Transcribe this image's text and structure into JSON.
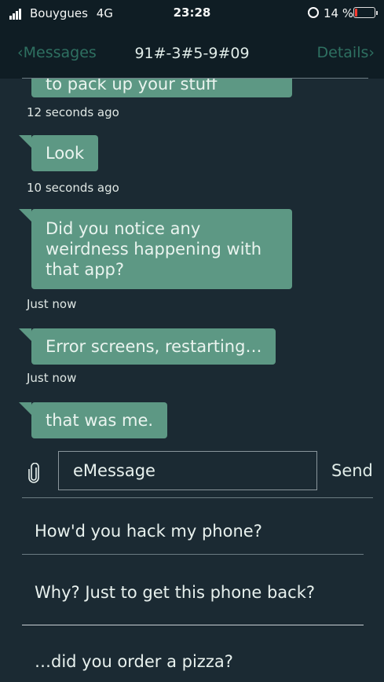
{
  "status_bar": {
    "carrier": "Bouygues",
    "network": "4G",
    "time": "23:28",
    "battery_percent": "14 %",
    "battery_level": 0.14
  },
  "navbar": {
    "back_label": "Messages",
    "title": "91#-3#5-9#09",
    "details_label": "Details"
  },
  "messages": [
    {
      "text": "to pack up your stuff",
      "time": "12 seconds ago"
    },
    {
      "text": "Look",
      "time": "10 seconds ago"
    },
    {
      "text": "Did you notice any weirdness happening with that app?",
      "time": "Just now"
    },
    {
      "text": "Error screens, restarting…",
      "time": "Just now"
    },
    {
      "text": "that was me.",
      "time": ""
    }
  ],
  "composer": {
    "placeholder": "eMessage",
    "send_label": "Send"
  },
  "reply_options": [
    "How'd you hack my phone?",
    "Why? Just to get this phone back?",
    "…did you order a pizza?"
  ],
  "colors": {
    "background": "#1b2a33",
    "bubble": "#5d9884",
    "accent": "#2e7061"
  }
}
